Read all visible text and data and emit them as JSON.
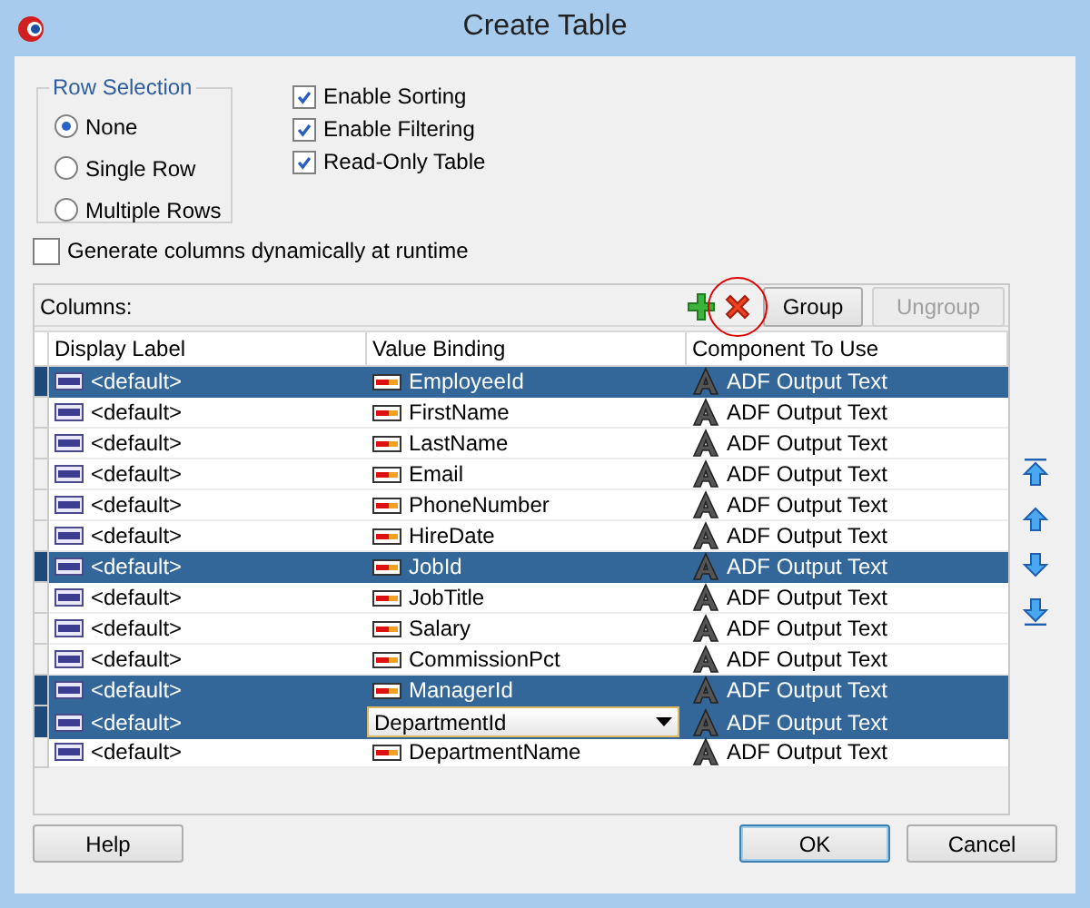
{
  "window": {
    "title": "Create Table"
  },
  "row_selection": {
    "label": "Row Selection",
    "options": [
      {
        "label": "None",
        "selected": true
      },
      {
        "label": "Single Row",
        "selected": false
      },
      {
        "label": "Multiple Rows",
        "selected": false
      }
    ]
  },
  "options": [
    {
      "label": "Enable Sorting",
      "checked": true
    },
    {
      "label": "Enable Filtering",
      "checked": true
    },
    {
      "label": "Read-Only Table",
      "checked": true
    }
  ],
  "generate_columns": {
    "label": "Generate columns dynamically at runtime",
    "checked": false
  },
  "columns_panel": {
    "label": "Columns:",
    "buttons": [
      {
        "label": "Group",
        "disabled": false
      },
      {
        "label": "Ungroup",
        "disabled": true
      }
    ]
  },
  "table": {
    "columns": [
      "Display Label",
      "Value Binding",
      "Component To Use"
    ],
    "rows": [
      {
        "display_label": "<default>",
        "value_binding": "EmployeeId",
        "component": "ADF Output Text",
        "selected": true,
        "editing": false
      },
      {
        "display_label": "<default>",
        "value_binding": "FirstName",
        "component": "ADF Output Text",
        "selected": false,
        "editing": false
      },
      {
        "display_label": "<default>",
        "value_binding": "LastName",
        "component": "ADF Output Text",
        "selected": false,
        "editing": false
      },
      {
        "display_label": "<default>",
        "value_binding": "Email",
        "component": "ADF Output Text",
        "selected": false,
        "editing": false
      },
      {
        "display_label": "<default>",
        "value_binding": "PhoneNumber",
        "component": "ADF Output Text",
        "selected": false,
        "editing": false
      },
      {
        "display_label": "<default>",
        "value_binding": "HireDate",
        "component": "ADF Output Text",
        "selected": false,
        "editing": false
      },
      {
        "display_label": "<default>",
        "value_binding": "JobId",
        "component": "ADF Output Text",
        "selected": true,
        "editing": false
      },
      {
        "display_label": "<default>",
        "value_binding": "JobTitle",
        "component": "ADF Output Text",
        "selected": false,
        "editing": false
      },
      {
        "display_label": "<default>",
        "value_binding": "Salary",
        "component": "ADF Output Text",
        "selected": false,
        "editing": false
      },
      {
        "display_label": "<default>",
        "value_binding": "CommissionPct",
        "component": "ADF Output Text",
        "selected": false,
        "editing": false
      },
      {
        "display_label": "<default>",
        "value_binding": "ManagerId",
        "component": "ADF Output Text",
        "selected": true,
        "editing": false
      },
      {
        "display_label": "<default>",
        "value_binding": "DepartmentId",
        "component": "ADF Output Text",
        "selected": true,
        "editing": true
      },
      {
        "display_label": "<default>",
        "value_binding": "DepartmentName",
        "component": "ADF Output Text",
        "selected": false,
        "editing": false
      }
    ]
  },
  "buttons": [
    {
      "label": "Help",
      "default": false
    },
    {
      "label": "OK",
      "default": true
    },
    {
      "label": "Cancel",
      "default": false
    }
  ]
}
